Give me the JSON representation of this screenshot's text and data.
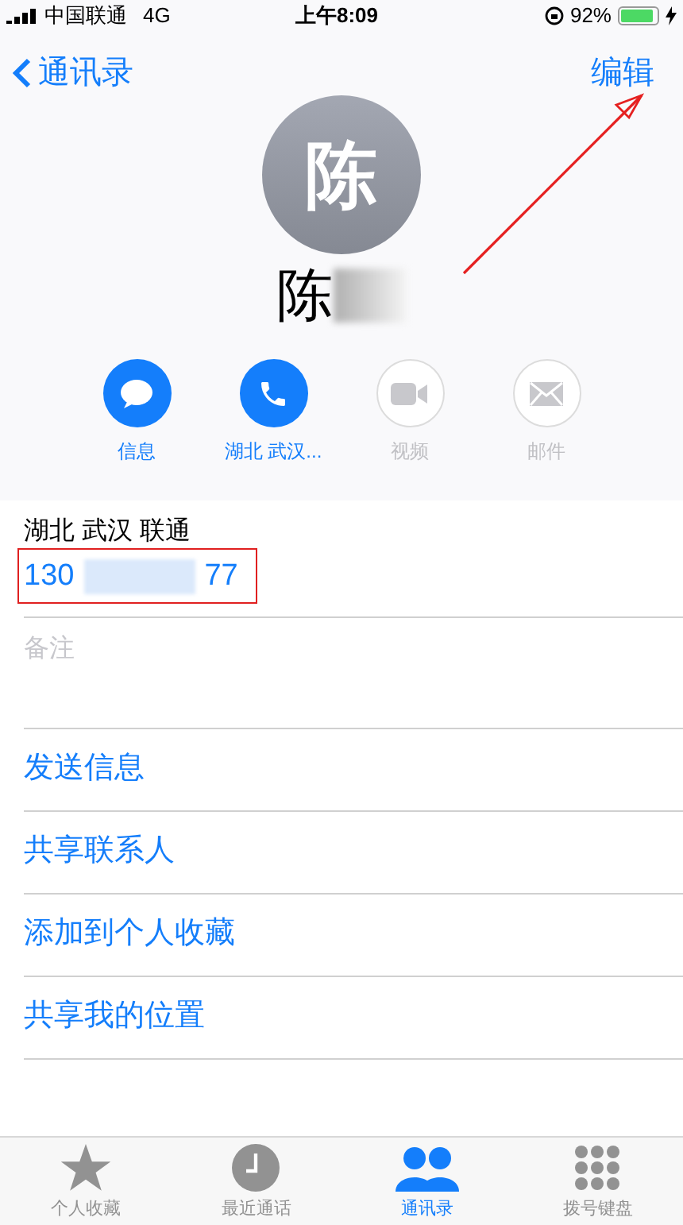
{
  "status_bar": {
    "carrier": "中国联通",
    "network": "4G",
    "time": "上午8:09",
    "battery": "92%",
    "battery_level": {
      "level": 0.92
    }
  },
  "nav": {
    "back": "通讯录",
    "edit": "编辑"
  },
  "contact": {
    "initial": "陈",
    "name": "陈"
  },
  "actions": [
    {
      "label": "信息",
      "kind": "message",
      "disabled": false
    },
    {
      "label": "湖北 武汉...",
      "kind": "call",
      "disabled": false
    },
    {
      "label": "视频",
      "kind": "video",
      "disabled": true
    },
    {
      "label": "邮件",
      "kind": "mail",
      "disabled": true
    }
  ],
  "phone": {
    "label": "湖北 武汉 联通",
    "number_start": "130",
    "number_end": "77"
  },
  "notes": {
    "placeholder": "备注"
  },
  "links": [
    "发送信息",
    "共享联系人",
    "添加到个人收藏",
    "共享我的位置"
  ],
  "tabs": [
    {
      "label": "个人收藏",
      "kind": "star",
      "selected": false
    },
    {
      "label": "最近通话",
      "kind": "clock",
      "selected": false
    },
    {
      "label": "通讯录",
      "kind": "people",
      "selected": true
    },
    {
      "label": "拨号键盘",
      "kind": "keypad",
      "selected": false
    }
  ]
}
